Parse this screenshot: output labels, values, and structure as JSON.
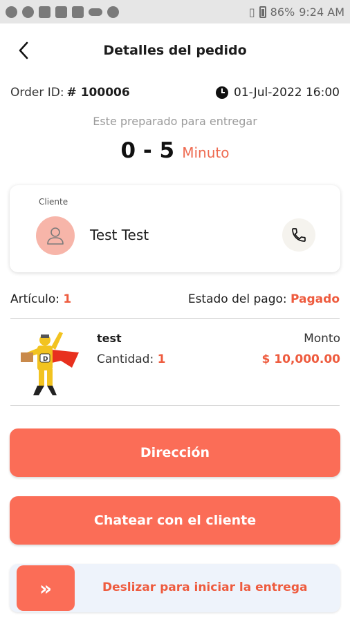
{
  "status_bar": {
    "battery": "86%",
    "time": "9:24 AM"
  },
  "header": {
    "title": "Detalles del pedido"
  },
  "order": {
    "id_label": "Order ID:",
    "id_value": "# 100006",
    "datetime": "01-Jul-2022 16:00",
    "prep_text": "Este preparado para entregar",
    "eta_range": "0 - 5",
    "eta_unit": "Minuto"
  },
  "customer": {
    "label": "Cliente",
    "name": "Test Test"
  },
  "summary": {
    "article_label": "Artículo:",
    "article_count": "1",
    "payment_label": "Estado del pago:",
    "payment_status": "Pagado"
  },
  "item": {
    "name": "test",
    "qty_label": "Cantidad:",
    "qty": "1",
    "amount_label": "Monto",
    "amount": "$ 10,000.00"
  },
  "actions": {
    "direction": "Dirección",
    "chat": "Chatear con el cliente",
    "slide_icon": "»",
    "slide_text": "Deslizar para iniciar la entrega"
  },
  "colors": {
    "accent": "#fb6d57",
    "accent_text": "#ee5b3e",
    "avatar_bg": "#f7b5a9"
  }
}
